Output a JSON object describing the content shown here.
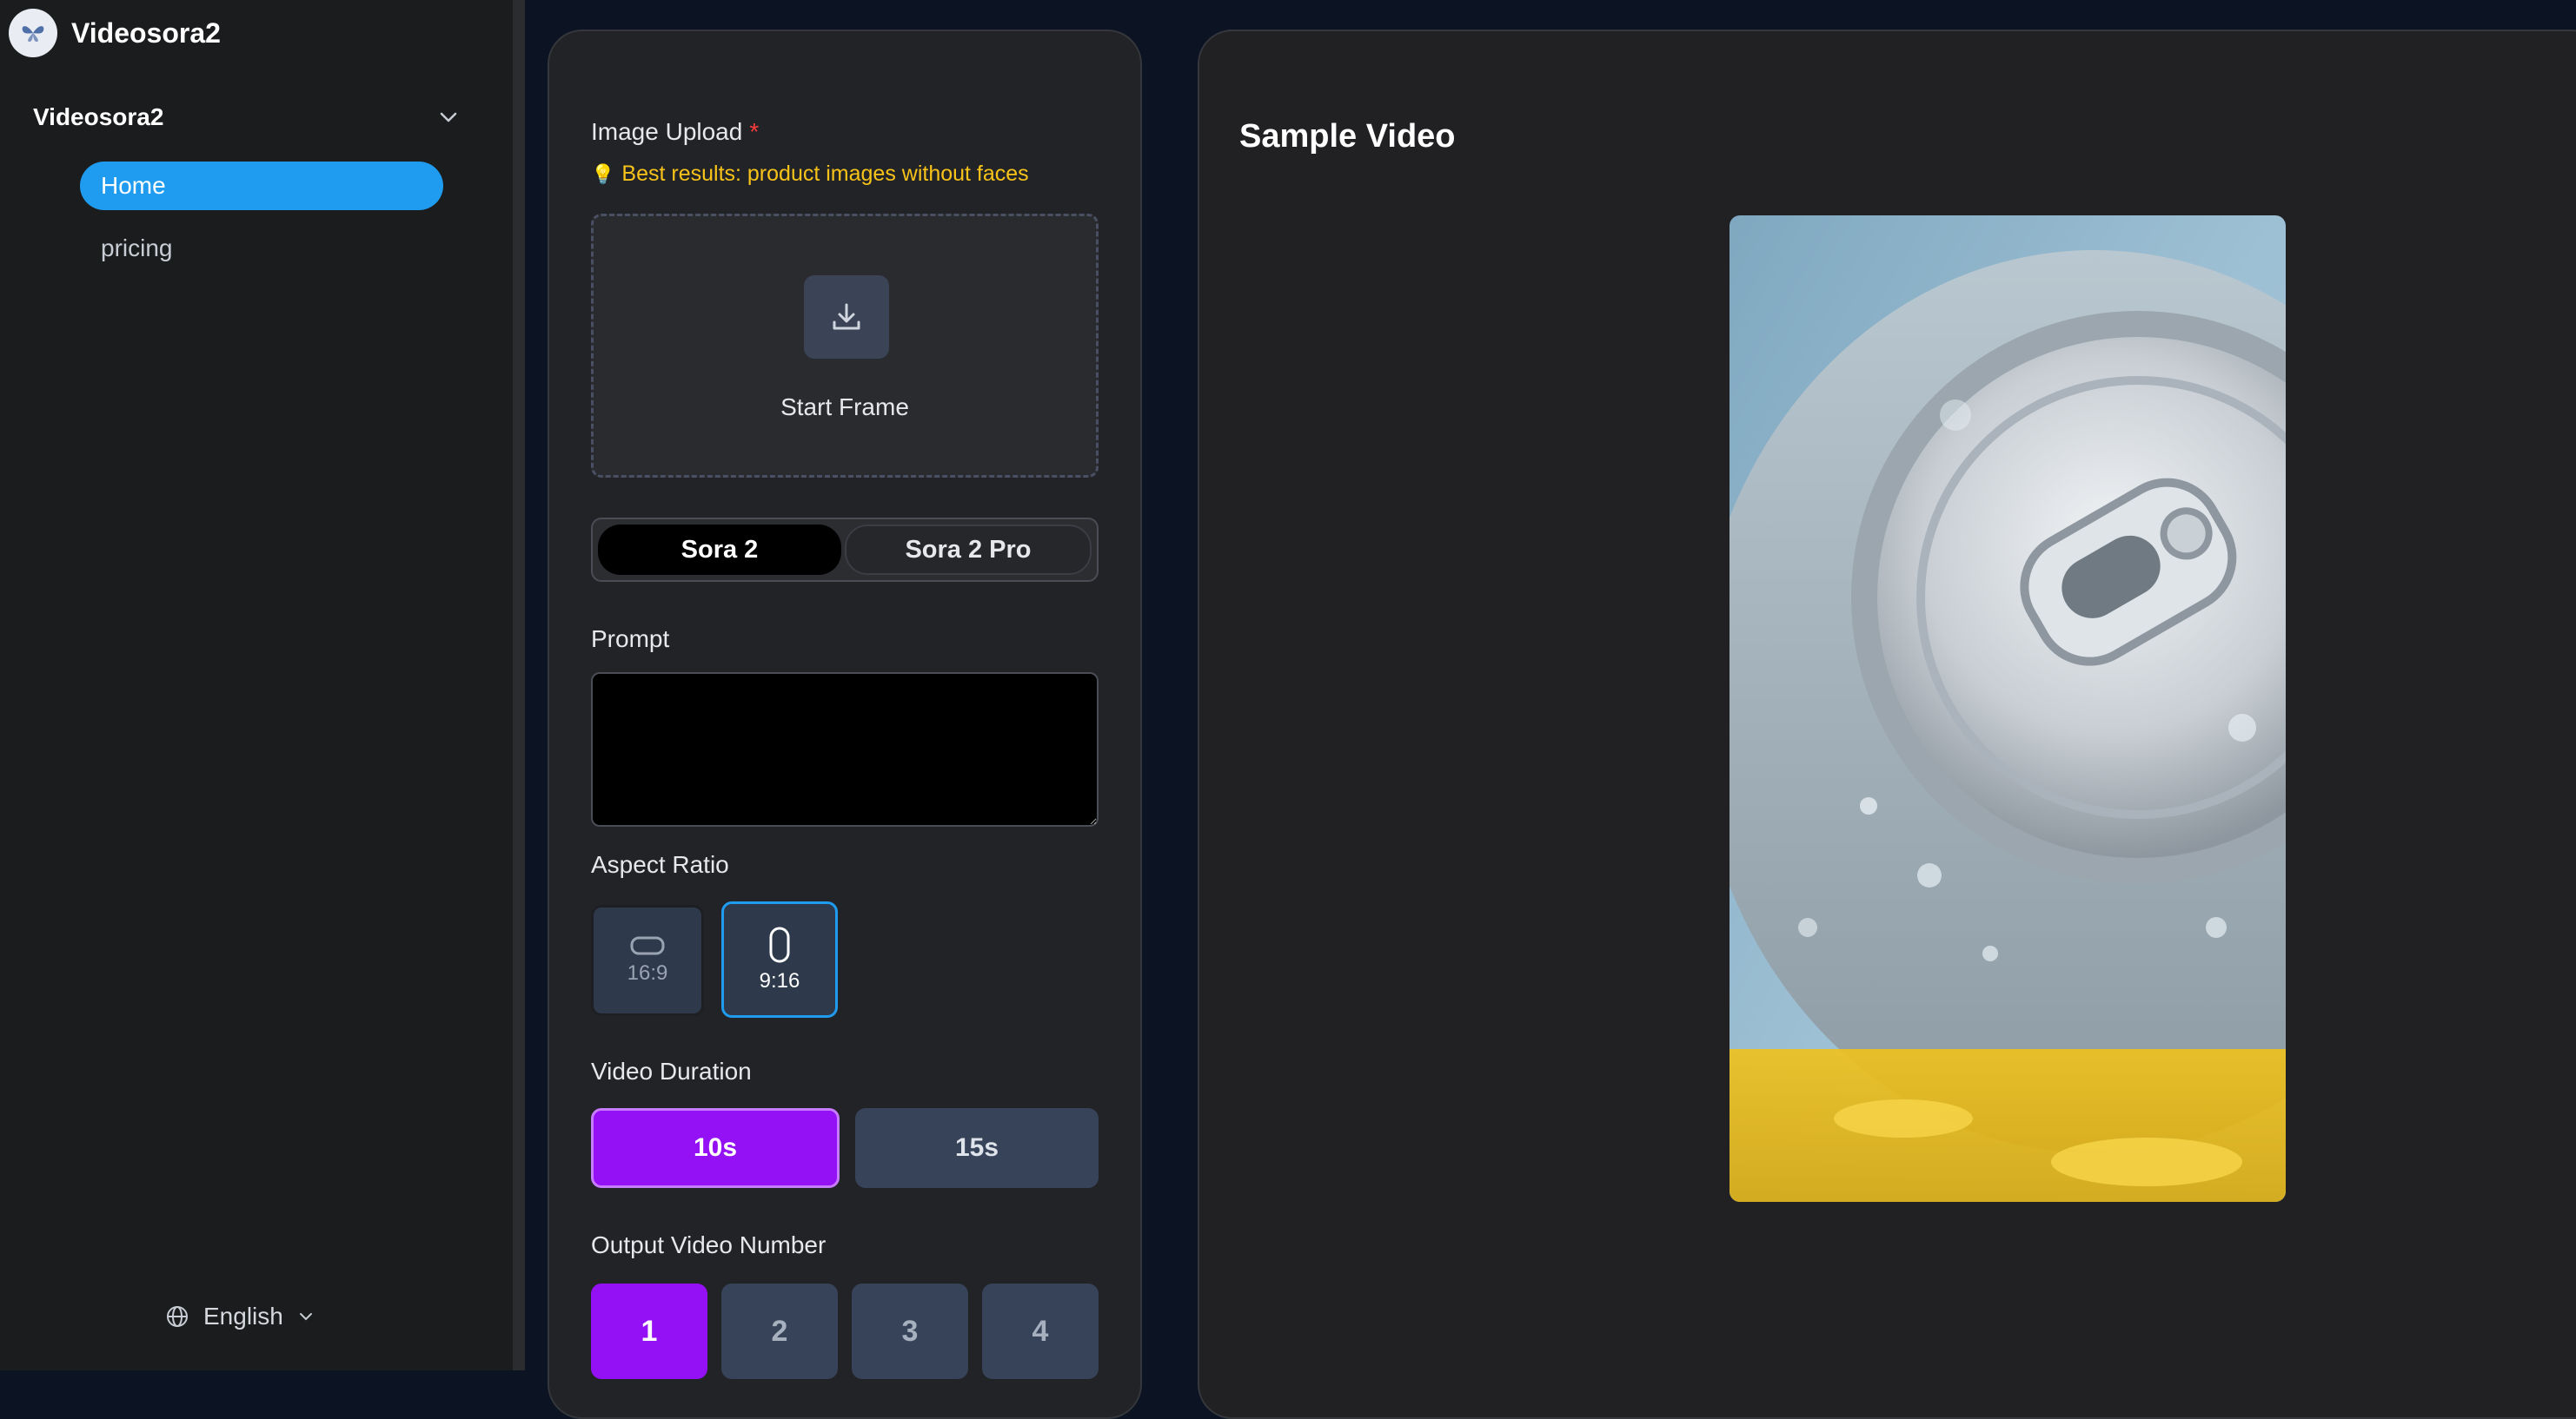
{
  "brand": {
    "name": "Videosora2",
    "logo_icon": "butterfly-logo-icon"
  },
  "sidebar": {
    "group_label": "Videosora2",
    "items": [
      {
        "label": "Home",
        "active": true
      },
      {
        "label": "pricing",
        "active": false
      }
    ],
    "language": "English",
    "accent_color": "#1f9cf0"
  },
  "form": {
    "image_upload": {
      "label": "Image Upload",
      "required_mark": "*",
      "hint_icon": "💡",
      "hint": "Best results: product images without faces",
      "dropzone_label": "Start Frame"
    },
    "models": [
      "Sora 2",
      "Sora 2 Pro"
    ],
    "selected_model": "Sora 2",
    "prompt": {
      "label": "Prompt",
      "value": "",
      "placeholder": ""
    },
    "aspect_ratio": {
      "label": "Aspect Ratio",
      "options": [
        {
          "label": "16:9",
          "selected": false
        },
        {
          "label": "9:16",
          "selected": true
        }
      ]
    },
    "duration": {
      "label": "Video Duration",
      "options": [
        {
          "label": "10s",
          "selected": true
        },
        {
          "label": "15s",
          "selected": false
        }
      ]
    },
    "output_number": {
      "label": "Output Video Number",
      "options": [
        "1",
        "2",
        "3",
        "4"
      ],
      "selected": "1"
    },
    "selected_color": "#9411f5"
  },
  "sample": {
    "title": "Sample Video"
  }
}
